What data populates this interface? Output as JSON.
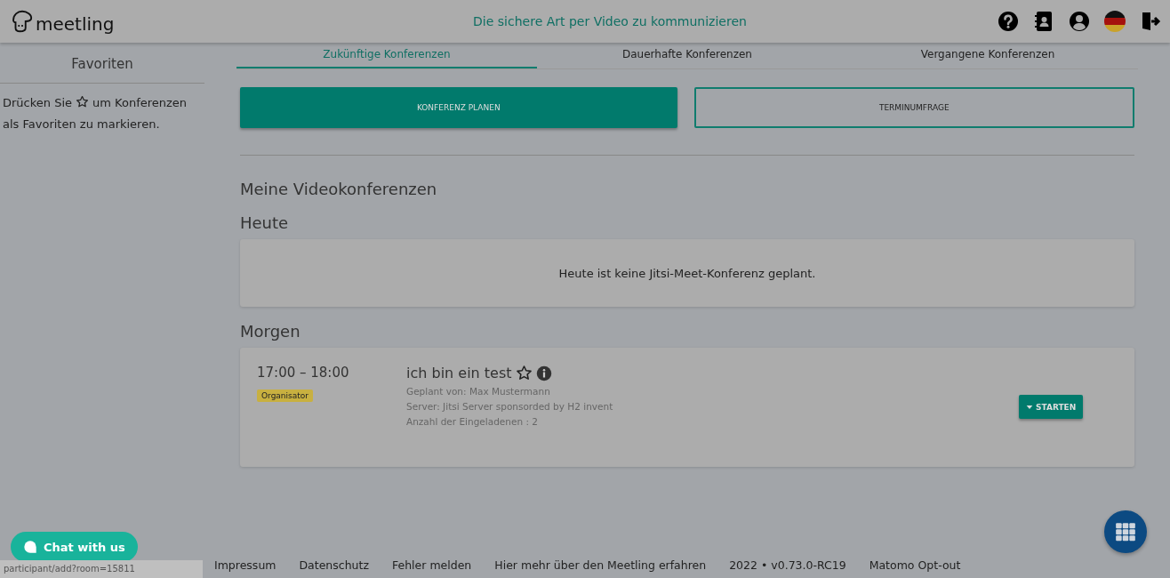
{
  "header": {
    "logo": "meetling",
    "tagline": "Die sichere Art per Video zu kommunizieren"
  },
  "sidebar": {
    "title": "Favoriten",
    "hint_before": "Drücken Sie",
    "hint_after": "um Konferenzen",
    "hint_line2": "als Favoriten zu markieren."
  },
  "tabs": [
    {
      "label": "Zukünftige Konferenzen",
      "selected": true
    },
    {
      "label": "Dauerhafte Konferenzen",
      "selected": false
    },
    {
      "label": "Vergangene Konferenzen",
      "selected": false
    }
  ],
  "actions": [
    {
      "label": "KONFERENZ PLANEN",
      "kind": "filled"
    },
    {
      "label": "TERMINUMFRAGE",
      "kind": "outline"
    }
  ],
  "heading": "Meine Videokonferenzen",
  "sections": [
    {
      "title": "Heute",
      "empty_message": "Heute ist keine Jitsi-Meet-Konferenz geplant."
    },
    {
      "title": "Morgen",
      "conferences": [
        {
          "time": "17:00 – 18:00",
          "badge": "Organisator",
          "title": "ich bin ein test",
          "favorite": false,
          "details": [
            "Geplant von: Max Mustermann",
            "Server: Jitsi Server sponsorded by H2 invent",
            "Anzahl der Eingeladenen : 2"
          ],
          "button": "STARTEN"
        }
      ]
    }
  ],
  "chat_button": "Chat with us",
  "status_url": "participant/add?room=15811",
  "footer": [
    "Impressum",
    "Datenschutz",
    "Fehler melden",
    "Hier mehr über den Meetling erfahren",
    "2022 • v0.73.0-RC19",
    "Matomo Opt-out"
  ]
}
